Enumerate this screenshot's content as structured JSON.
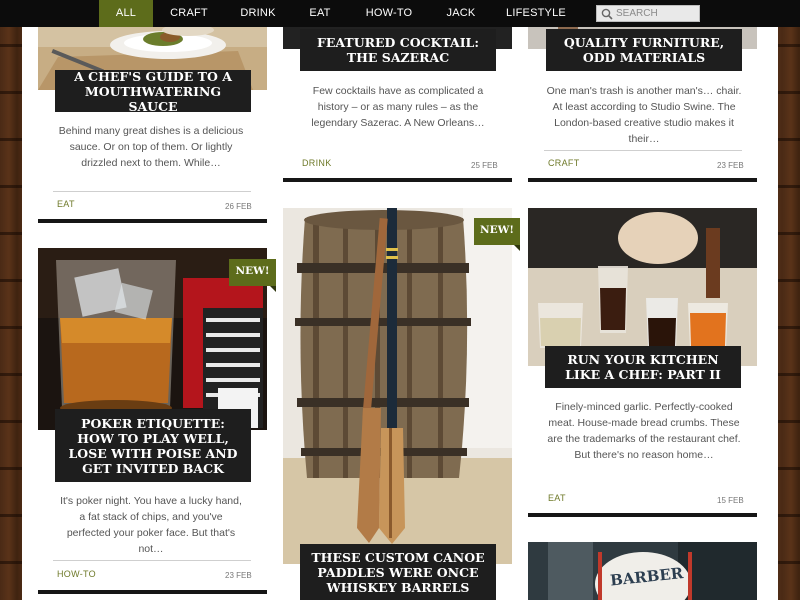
{
  "nav": {
    "items": [
      {
        "label": "ALL",
        "active": true
      },
      {
        "label": "CRAFT"
      },
      {
        "label": "DRINK"
      },
      {
        "label": "EAT"
      },
      {
        "label": "HOW-TO"
      },
      {
        "label": "JACK"
      },
      {
        "label": "LIFESTYLE"
      }
    ],
    "search_placeholder": "SEARCH",
    "active_color": "#5d6c1b"
  },
  "badge_label": "NEW!",
  "articles": [
    {
      "id": "chefs-sauce",
      "title": "A Chef's Guide to a Mouthwatering Sauce",
      "excerpt": "Behind many great dishes is a delicious sauce. Or on top of them. Or lightly drizzled next to them. While…",
      "category": "EAT",
      "date": "26 FEB"
    },
    {
      "id": "sazerac",
      "title": "Featured Cocktail: The Sazerac",
      "excerpt": "Few cocktails have as complicated a history – or as many rules – as the legendary Sazerac. A New Orleans…",
      "category": "DRINK",
      "date": "25 FEB"
    },
    {
      "id": "furniture",
      "title": "Quality Furniture, Odd Materials",
      "excerpt": "One man's trash is another man's… chair. At least according to Studio Swine. The London-based creative studio makes it their…",
      "category": "CRAFT",
      "date": "23 FEB"
    },
    {
      "id": "poker",
      "title": "Poker Etiquette: How to Play Well, Lose with Poise and Get Invited Back",
      "excerpt": "It's poker night. You have a lucky hand, a fat stack of chips, and you've perfected your poker face. But that's not…",
      "category": "HOW-TO",
      "date": "23 FEB",
      "new": true
    },
    {
      "id": "canoe",
      "title": "These Custom Canoe Paddles Were Once Whiskey Barrels",
      "new": true
    },
    {
      "id": "kitchen",
      "title": "Run Your Kitchen Like a Chef: Part II",
      "excerpt": "Finely-minced garlic. Perfectly-cooked meat. House-made bread crumbs. These are the trademarks of the restaurant chef. But there's no reason home…",
      "category": "EAT",
      "date": "15 FEB"
    },
    {
      "id": "barber",
      "sign_text": "BARBER"
    }
  ]
}
